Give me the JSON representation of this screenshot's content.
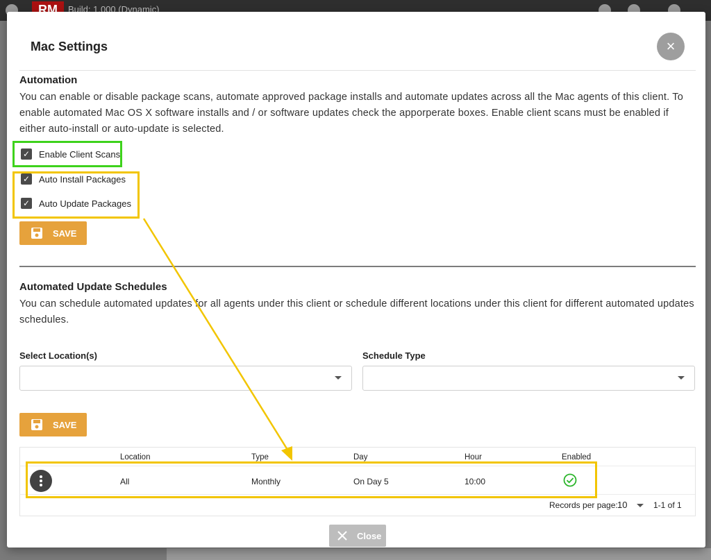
{
  "background": {
    "build_text": "Build: 1.000 (Dynamic)",
    "logo_text": "RM"
  },
  "modal": {
    "title": "Mac Settings",
    "close_icon": "×"
  },
  "automation": {
    "title": "Automation",
    "description": "You can enable or disable package scans, automate approved package installs and automate updates across all the Mac agents of this client. To enable automated Mac OS X software installs and / or software updates check the apporperate boxes. Enable client scans must be enabled if either auto-install or auto-update is selected.",
    "checkboxes": [
      {
        "label": "Enable Client Scans",
        "checked": true
      },
      {
        "label": "Auto Install Packages",
        "checked": true
      },
      {
        "label": "Auto Update Packages",
        "checked": true
      }
    ],
    "save_label": "SAVE"
  },
  "schedules": {
    "title": "Automated Update Schedules",
    "description": "You can schedule automated updates for all agents under this client or schedule different locations under this client for different automated updates schedules.",
    "location_label": "Select Location(s)",
    "location_value": "",
    "type_label": "Schedule Type",
    "type_value": "",
    "save_label": "SAVE"
  },
  "table": {
    "headers": [
      "Location",
      "Type",
      "Day",
      "Hour",
      "Enabled"
    ],
    "rows": [
      {
        "location": "All",
        "type": "Monthly",
        "day": "On Day 5",
        "hour": "10:00",
        "enabled": true
      }
    ],
    "records_per_page_label": "Records per page:",
    "records_per_page": "10",
    "range": "1-1 of 1"
  },
  "footer": {
    "close_label": "Close"
  },
  "colors": {
    "accent": "#e6a23c",
    "highlight_green": "#3ed21c",
    "highlight_yellow": "#f2c500",
    "success": "#2bb52b"
  }
}
